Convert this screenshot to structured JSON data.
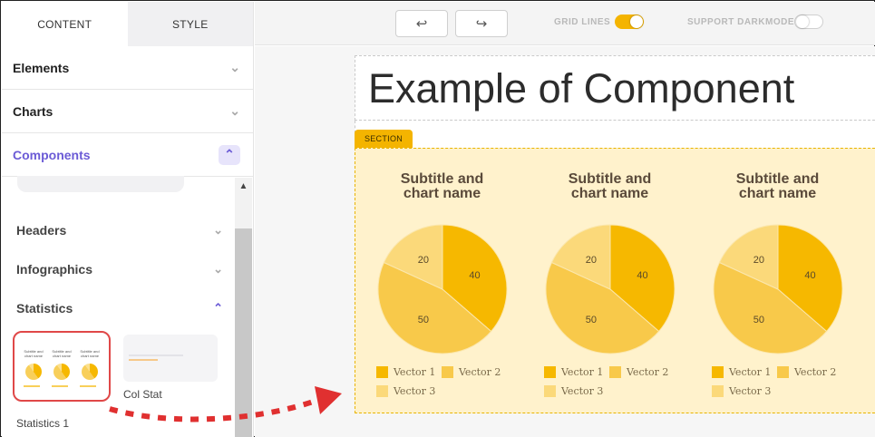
{
  "tabs": [
    {
      "label": "CONTENT"
    },
    {
      "label": "STYLE"
    }
  ],
  "accordion": [
    {
      "label": "Elements",
      "icon": "chevron-down-icon"
    },
    {
      "label": "Charts",
      "icon": "chevron-down-icon"
    },
    {
      "label": "Components",
      "icon": "chevron-up-icon"
    }
  ],
  "subsections": [
    {
      "label": "Headers",
      "icon": "chevron-down-icon"
    },
    {
      "label": "Infographics",
      "icon": "chevron-down-icon"
    },
    {
      "label": "Statistics",
      "icon": "chevron-up-icon"
    }
  ],
  "thumbnails": [
    {
      "label": "Statistics 1",
      "selected": true
    },
    {
      "label": "Col Stat",
      "selected": false
    }
  ],
  "toolbar": {
    "undo_icon": "undo-icon",
    "redo_icon": "redo-icon",
    "grid_lines_label": "GRID LINES",
    "grid_lines_on": true,
    "darkmode_label": "SUPPORT DARKMODE",
    "darkmode_on": false
  },
  "canvas": {
    "title": "Example of Component",
    "section_tag": "SECTION"
  },
  "colors": {
    "accent": "#6b5bd6",
    "amber": "#f4b400",
    "section_bg": "#fff2cc",
    "vector1": "#f6b800",
    "vector2": "#f8c94a",
    "vector3": "#fbd97a",
    "arrow": "#e03030"
  },
  "chart_data": [
    {
      "type": "pie",
      "title": "Subtitle and chart name",
      "categories": [
        "Vector 1",
        "Vector 2",
        "Vector 3"
      ],
      "values": [
        40,
        50,
        20
      ],
      "legend": "bottom"
    },
    {
      "type": "pie",
      "title": "Subtitle and chart name",
      "categories": [
        "Vector 1",
        "Vector 2",
        "Vector 3"
      ],
      "values": [
        40,
        50,
        20
      ],
      "legend": "bottom"
    },
    {
      "type": "pie",
      "title": "Subtitle and chart name",
      "categories": [
        "Vector 1",
        "Vector 2",
        "Vector 3"
      ],
      "values": [
        40,
        50,
        20
      ],
      "legend": "bottom"
    }
  ]
}
